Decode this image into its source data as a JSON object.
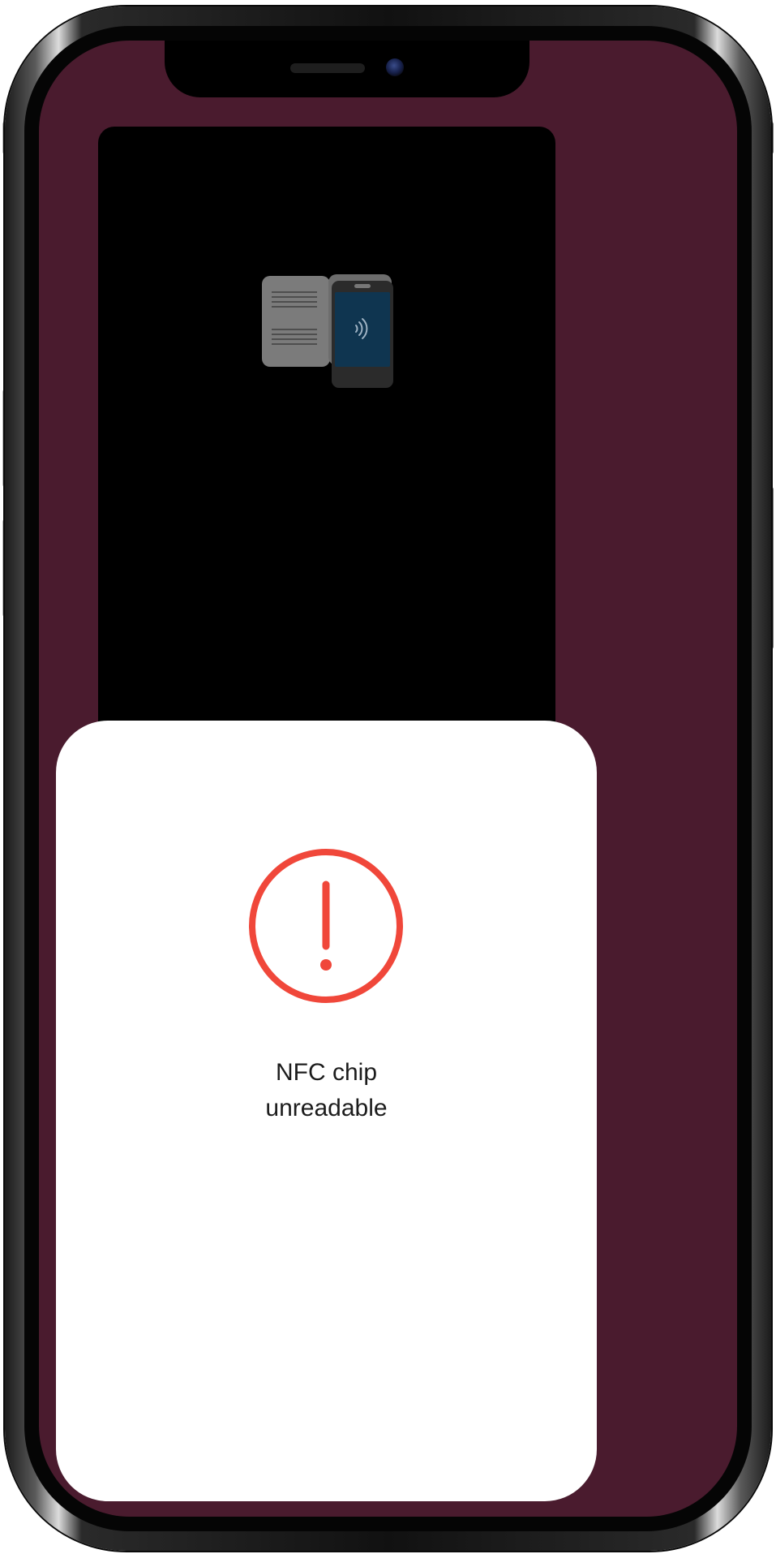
{
  "device": {
    "screen_color": "#4a1b2e",
    "camera_area_color": "#000000"
  },
  "illustration": {
    "icon": "passport-nfc-phone-icon",
    "phone_screen_color": "#0f3550"
  },
  "sheet": {
    "status_icon": "exclamation-circle-icon",
    "status_color": "#f0473a",
    "status_lines": [
      "NFC chip",
      "unreadable"
    ]
  }
}
